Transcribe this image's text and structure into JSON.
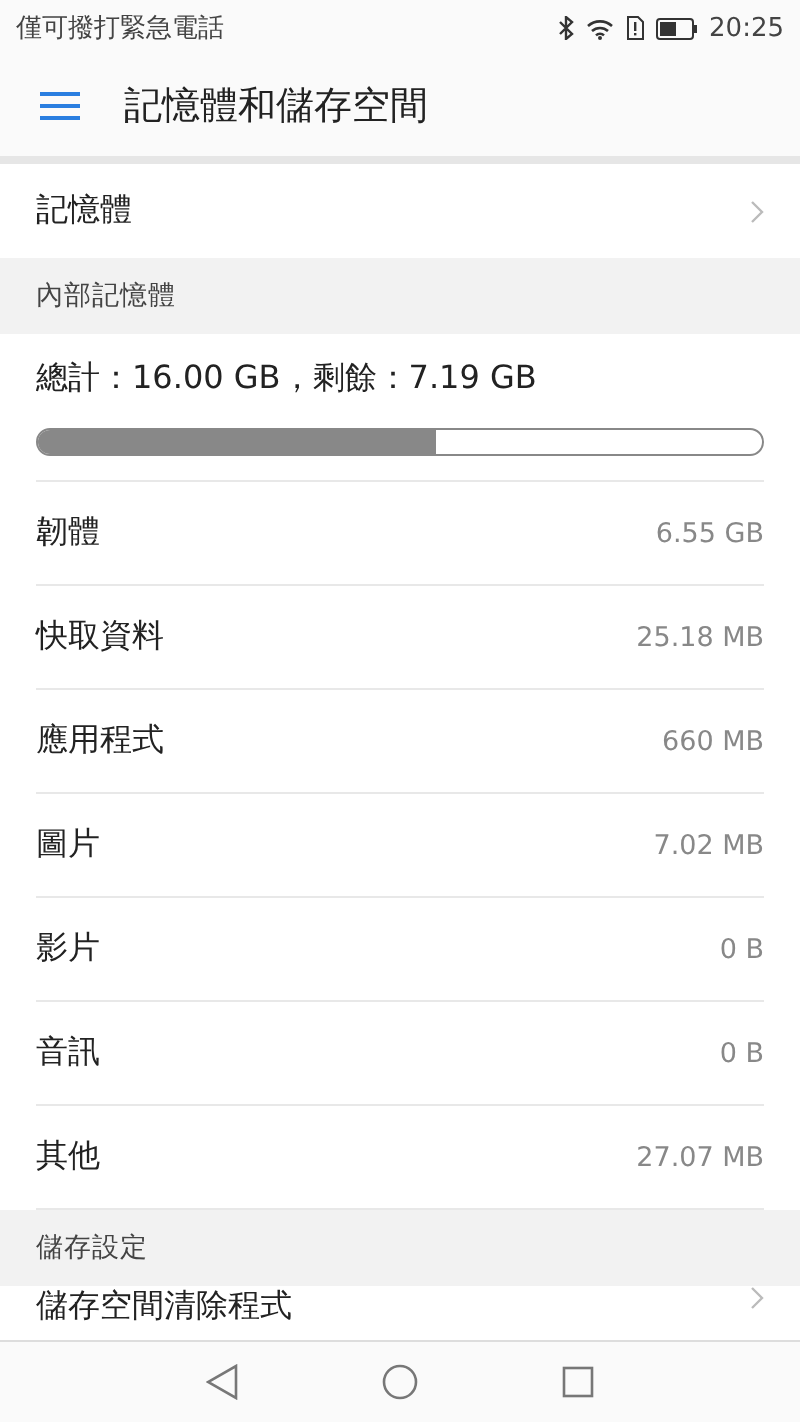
{
  "status_bar": {
    "carrier": "僅可撥打緊急電話",
    "time": "20:25"
  },
  "app_bar": {
    "title": "記憶體和儲存空間"
  },
  "memory_row": {
    "label": "記憶體"
  },
  "internal": {
    "header": "內部記憶體",
    "summary": "總計：16.00 GB，剩餘：7.19 GB",
    "level": 0.55,
    "rows": [
      {
        "label": "韌體",
        "value": "6.55 GB"
      },
      {
        "label": "快取資料",
        "value": "25.18 MB"
      },
      {
        "label": "應用程式",
        "value": "660 MB"
      },
      {
        "label": "圖片",
        "value": "7.02 MB"
      },
      {
        "label": "影片",
        "value": "0 B"
      },
      {
        "label": "音訊",
        "value": "0 B"
      },
      {
        "label": "其他",
        "value": "27.07 MB"
      }
    ]
  },
  "settings": {
    "header": "儲存設定",
    "rows": [
      {
        "label": "儲存空間清除程式"
      }
    ]
  }
}
